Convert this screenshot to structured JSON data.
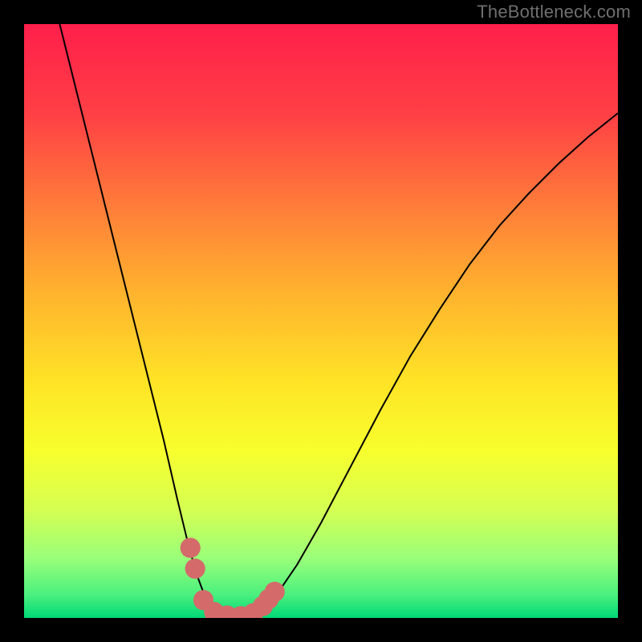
{
  "watermark": "TheBottleneck.com",
  "chart_data": {
    "type": "line",
    "title": "",
    "xlabel": "",
    "ylabel": "",
    "xlim": [
      0,
      1
    ],
    "ylim": [
      0,
      1
    ],
    "background_gradient": {
      "stops": [
        {
          "offset": 0.0,
          "color": "#ff1f4b"
        },
        {
          "offset": 0.15,
          "color": "#ff3f45"
        },
        {
          "offset": 0.3,
          "color": "#ff7a3a"
        },
        {
          "offset": 0.45,
          "color": "#ffb22e"
        },
        {
          "offset": 0.6,
          "color": "#ffe326"
        },
        {
          "offset": 0.72,
          "color": "#f7ff2e"
        },
        {
          "offset": 0.82,
          "color": "#d4ff53"
        },
        {
          "offset": 0.9,
          "color": "#99ff7a"
        },
        {
          "offset": 0.96,
          "color": "#4cf07e"
        },
        {
          "offset": 1.0,
          "color": "#00d977"
        }
      ]
    },
    "series": [
      {
        "name": "bottleneck-curve",
        "color": "#000000",
        "points": [
          [
            0.06,
            1.0
          ],
          [
            0.085,
            0.9
          ],
          [
            0.11,
            0.8
          ],
          [
            0.135,
            0.7
          ],
          [
            0.16,
            0.6
          ],
          [
            0.185,
            0.5
          ],
          [
            0.21,
            0.4
          ],
          [
            0.235,
            0.3
          ],
          [
            0.258,
            0.2
          ],
          [
            0.275,
            0.13
          ],
          [
            0.29,
            0.075
          ],
          [
            0.305,
            0.035
          ],
          [
            0.32,
            0.013
          ],
          [
            0.335,
            0.004
          ],
          [
            0.35,
            0.002
          ],
          [
            0.37,
            0.003
          ],
          [
            0.39,
            0.01
          ],
          [
            0.41,
            0.024
          ],
          [
            0.43,
            0.046
          ],
          [
            0.46,
            0.09
          ],
          [
            0.5,
            0.16
          ],
          [
            0.55,
            0.255
          ],
          [
            0.6,
            0.35
          ],
          [
            0.65,
            0.44
          ],
          [
            0.7,
            0.52
          ],
          [
            0.75,
            0.595
          ],
          [
            0.8,
            0.66
          ],
          [
            0.85,
            0.715
          ],
          [
            0.9,
            0.765
          ],
          [
            0.95,
            0.81
          ],
          [
            1.0,
            0.85
          ]
        ]
      }
    ],
    "markers": {
      "color": "#d46a6a",
      "radius_frac": 0.017,
      "points": [
        [
          0.28,
          0.118
        ],
        [
          0.288,
          0.083
        ],
        [
          0.302,
          0.03
        ],
        [
          0.32,
          0.01
        ],
        [
          0.342,
          0.004
        ],
        [
          0.365,
          0.003
        ],
        [
          0.386,
          0.008
        ],
        [
          0.402,
          0.02
        ],
        [
          0.412,
          0.032
        ],
        [
          0.422,
          0.044
        ]
      ]
    }
  }
}
